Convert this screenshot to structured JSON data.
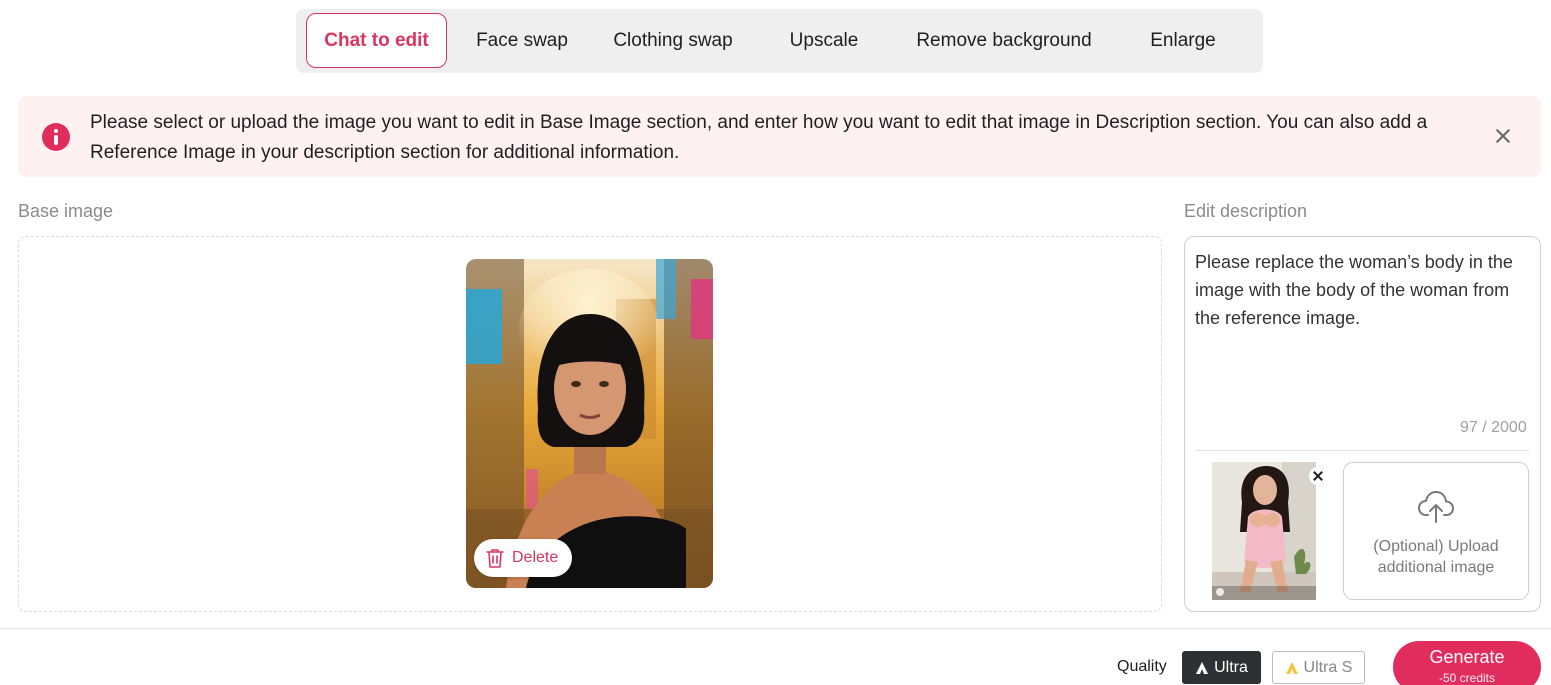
{
  "tabs": [
    {
      "label": "Chat to edit",
      "active": true
    },
    {
      "label": "Face swap",
      "active": false
    },
    {
      "label": "Clothing swap",
      "active": false
    },
    {
      "label": "Upscale",
      "active": false
    },
    {
      "label": "Remove background",
      "active": false
    },
    {
      "label": "Enlarge",
      "active": false
    }
  ],
  "banner": {
    "text": "Please select or upload the image you want to edit in Base Image section, and enter how you want to edit that image in Description section. You can also add a Reference Image in your description section for additional information.",
    "icon": "info-icon",
    "accent_color": "#e12d5d",
    "background_color": "#fdf2f1"
  },
  "base_image": {
    "label": "Base image",
    "delete_label": "Delete"
  },
  "edit_description": {
    "label": "Edit description",
    "text": "Please replace the woman’s body in the image with the body of the woman from the reference image.",
    "char_count": "97 / 2000",
    "upload_label": "(Optional) Upload additional image"
  },
  "footer": {
    "quality_label": "Quality",
    "quality_options": [
      {
        "label": "Ultra",
        "selected": true
      },
      {
        "label": "Ultra S",
        "selected": false
      }
    ],
    "generate_label": "Generate",
    "generate_cost": "-50 credits"
  },
  "colors": {
    "brand": "#e12d5d",
    "active_tab_text": "#d8365e",
    "selected_quality_bg": "#2f3033"
  }
}
